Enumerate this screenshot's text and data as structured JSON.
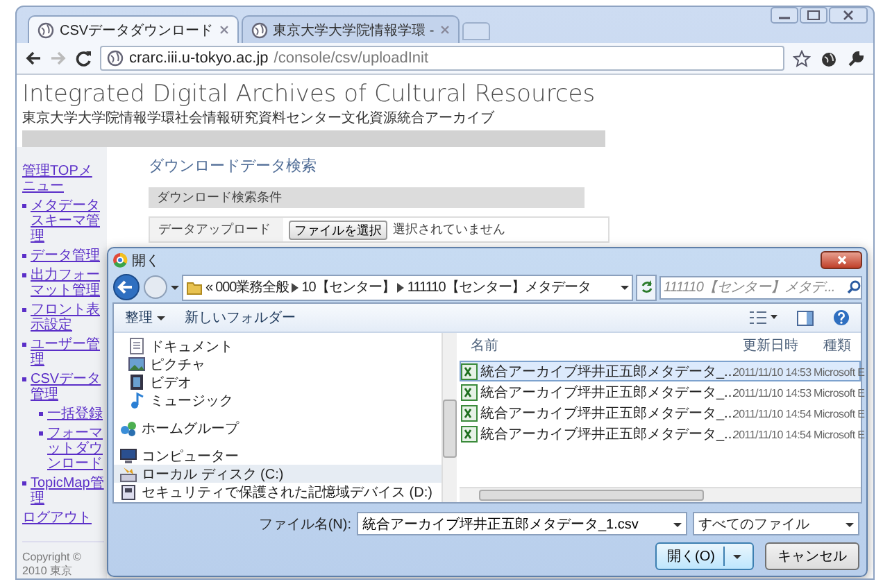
{
  "browser": {
    "tabs": [
      {
        "title": "CSVデータダウンロード",
        "selected": true
      },
      {
        "title": "東京大学大学院情報学環 -",
        "selected": false
      }
    ],
    "url_host": "crarc.iii.u-tokyo.ac.jp",
    "url_path": "/console/csv/uploadInit"
  },
  "page": {
    "site_title": "Integrated Digital Archives of Cultural Resources",
    "site_subtitle": "東京大学大学院情報学環社会情報研究資料センター文化資源統合アーカイブ",
    "sidebar": {
      "heading": "管理TOPメニュー",
      "items": [
        {
          "label": "メタデータスキーマ管理"
        },
        {
          "label": "データ管理"
        },
        {
          "label": "出力フォーマット管理"
        },
        {
          "label": "フロント表示設定"
        },
        {
          "label": "ユーザー管理"
        },
        {
          "label": "CSVデータ管理",
          "children": [
            {
              "label": "一括登録"
            },
            {
              "label": "フォーマットダウンロード"
            }
          ]
        },
        {
          "label": "TopicMap管理"
        }
      ],
      "logout": "ログアウト"
    },
    "main": {
      "heading": "ダウンロードデータ検索",
      "section": "ダウンロード検索条件",
      "upload_label": "データアップロード",
      "file_button": "ファイルを選択",
      "file_status": "選択されていません"
    },
    "footer": "Copyright © 2010 東京"
  },
  "dialog": {
    "title": "開く",
    "breadcrumb_overflow": "«",
    "breadcrumb": [
      "000業務全般",
      "10【センター】",
      "111110【センター】メタデータ"
    ],
    "search_placeholder": "111110【センター】メタデ...",
    "toolbar": [
      {
        "label": "整理",
        "dropdown": true
      },
      {
        "label": "新しいフォルダー",
        "dropdown": false
      }
    ],
    "nav_groups": [
      {
        "items": [
          {
            "label": "ドキュメント",
            "kind": "documents",
            "selected": false
          },
          {
            "label": "ピクチャ",
            "kind": "pictures",
            "selected": false
          },
          {
            "label": "ビデオ",
            "kind": "videos",
            "selected": false
          },
          {
            "label": "ミュージック",
            "kind": "music",
            "selected": false
          }
        ]
      },
      {
        "items": [
          {
            "label": "ホームグループ",
            "kind": "homegroup",
            "selected": false
          }
        ]
      },
      {
        "items": [
          {
            "label": "コンピューター",
            "kind": "computer",
            "selected": false
          },
          {
            "label": "ローカル ディスク (C:)",
            "kind": "drive",
            "selected": true
          },
          {
            "label": "セキュリティで保護された記憶域デバイス (D:)",
            "kind": "device",
            "selected": false
          }
        ]
      }
    ],
    "columns": [
      "名前",
      "更新日時",
      "種類"
    ],
    "files": [
      {
        "name": "統合アーカイブ坪井正五郎メタデータ_...",
        "modified": "2011/11/10 14:53",
        "type": "Microsoft E",
        "selected": true
      },
      {
        "name": "統合アーカイブ坪井正五郎メタデータ_...",
        "modified": "2011/11/10 14:53",
        "type": "Microsoft E",
        "selected": false
      },
      {
        "name": "統合アーカイブ坪井正五郎メタデータ_...",
        "modified": "2011/11/10 14:54",
        "type": "Microsoft E",
        "selected": false
      },
      {
        "name": "統合アーカイブ坪井正五郎メタデータ_...",
        "modified": "2011/11/10 14:54",
        "type": "Microsoft E",
        "selected": false
      }
    ],
    "filename_label": "ファイル名(N):",
    "filename": "統合アーカイブ坪井正五郎メタデータ_1.csv",
    "filter": "すべてのファイル",
    "open_button": "開く(O)",
    "cancel_button": "キャンセル"
  }
}
